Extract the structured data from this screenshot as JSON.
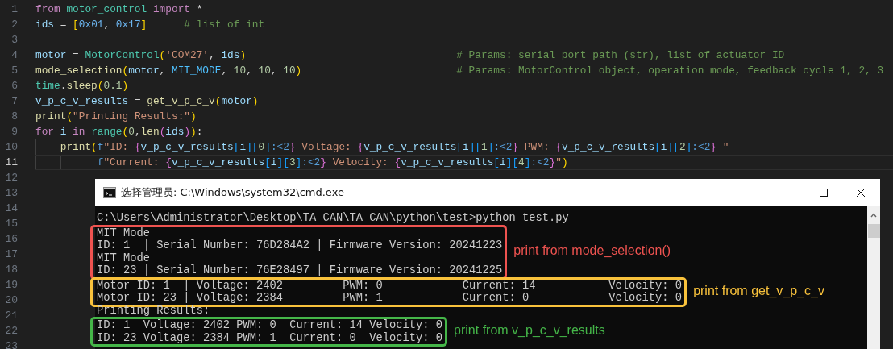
{
  "editor": {
    "lines": [
      {
        "number": "1",
        "current": false,
        "tokens": [
          {
            "text": "from",
            "kind": "keyword"
          },
          {
            "text": " motor_control",
            "kind": "type"
          },
          {
            "text": " import",
            "kind": "keyword"
          },
          {
            "text": " *",
            "kind": "plain"
          }
        ]
      },
      {
        "number": "2",
        "current": false,
        "tokens": [
          {
            "text": "ids",
            "kind": "variable"
          },
          {
            "text": " = ",
            "kind": "plain"
          },
          {
            "text": "[",
            "kind": "bracket1"
          },
          {
            "text": "0x01",
            "kind": "hex"
          },
          {
            "text": ", ",
            "kind": "plain"
          },
          {
            "text": "0x17",
            "kind": "hex"
          },
          {
            "text": "]",
            "kind": "bracket1"
          },
          {
            "text": "      # list of int",
            "kind": "comment"
          }
        ]
      },
      {
        "number": "3",
        "current": false
      },
      {
        "number": "4",
        "current": false,
        "tokens": [
          {
            "text": "motor",
            "kind": "variable"
          },
          {
            "text": " = ",
            "kind": "plain"
          },
          {
            "text": "MotorControl",
            "kind": "type"
          },
          {
            "text": "(",
            "kind": "bracket1"
          },
          {
            "text": "'COM27'",
            "kind": "string"
          },
          {
            "text": ", ",
            "kind": "plain"
          },
          {
            "text": "ids",
            "kind": "variable"
          },
          {
            "text": ")",
            "kind": "bracket1"
          },
          {
            "text": "                                  # Params: serial port path (str), list of actuator ID",
            "kind": "comment"
          }
        ]
      },
      {
        "number": "5",
        "current": false,
        "tokens": [
          {
            "text": "mode_selection",
            "kind": "function"
          },
          {
            "text": "(",
            "kind": "bracket1"
          },
          {
            "text": "motor",
            "kind": "variable"
          },
          {
            "text": ", ",
            "kind": "plain"
          },
          {
            "text": "MIT_MODE",
            "kind": "constant"
          },
          {
            "text": ", ",
            "kind": "plain"
          },
          {
            "text": "10",
            "kind": "number"
          },
          {
            "text": ", ",
            "kind": "plain"
          },
          {
            "text": "10",
            "kind": "number"
          },
          {
            "text": ", ",
            "kind": "plain"
          },
          {
            "text": "10",
            "kind": "number"
          },
          {
            "text": ")",
            "kind": "bracket1"
          },
          {
            "text": "                         # Params: MotorControl object, operation mode, feedback cycle 1, 2, 3",
            "kind": "comment"
          }
        ]
      },
      {
        "number": "6",
        "current": false,
        "tokens": [
          {
            "text": "time",
            "kind": "type"
          },
          {
            "text": ".",
            "kind": "plain"
          },
          {
            "text": "sleep",
            "kind": "function"
          },
          {
            "text": "(",
            "kind": "bracket1"
          },
          {
            "text": "0.1",
            "kind": "number"
          },
          {
            "text": ")",
            "kind": "bracket1"
          }
        ]
      },
      {
        "number": "7",
        "current": false,
        "tokens": [
          {
            "text": "v_p_c_v_results",
            "kind": "variable"
          },
          {
            "text": " = ",
            "kind": "plain"
          },
          {
            "text": "get_v_p_c_v",
            "kind": "function"
          },
          {
            "text": "(",
            "kind": "bracket1"
          },
          {
            "text": "motor",
            "kind": "variable"
          },
          {
            "text": ")",
            "kind": "bracket1"
          }
        ]
      },
      {
        "number": "8",
        "current": false,
        "tokens": [
          {
            "text": "print",
            "kind": "function"
          },
          {
            "text": "(",
            "kind": "bracket1"
          },
          {
            "text": "\"Printing Results:\"",
            "kind": "string"
          },
          {
            "text": ")",
            "kind": "bracket1"
          }
        ]
      },
      {
        "number": "9",
        "current": false,
        "tokens": [
          {
            "text": "for",
            "kind": "keyword"
          },
          {
            "text": " i",
            "kind": "variable"
          },
          {
            "text": " in",
            "kind": "keyword"
          },
          {
            "text": " range",
            "kind": "type"
          },
          {
            "text": "(",
            "kind": "bracket1"
          },
          {
            "text": "0",
            "kind": "number"
          },
          {
            "text": ",",
            "kind": "plain"
          },
          {
            "text": "len",
            "kind": "function"
          },
          {
            "text": "(",
            "kind": "bracket2"
          },
          {
            "text": "ids",
            "kind": "variable"
          },
          {
            "text": ")",
            "kind": "bracket2"
          },
          {
            "text": ")",
            "kind": "bracket1"
          },
          {
            "text": ":",
            "kind": "plain"
          }
        ]
      },
      {
        "number": "10",
        "current": false,
        "kind": "block",
        "tokens": [
          {
            "text": "print",
            "kind": "function"
          },
          {
            "text": "(",
            "kind": "bracket1"
          },
          {
            "text": "f",
            "kind": "prefix"
          },
          {
            "text": "\"ID: ",
            "kind": "string"
          },
          {
            "text": "{",
            "kind": "bracket2"
          },
          {
            "text": "v_p_c_v_results",
            "kind": "variable"
          },
          {
            "text": "[",
            "kind": "bracket3"
          },
          {
            "text": "i",
            "kind": "variable"
          },
          {
            "text": "]",
            "kind": "bracket3"
          },
          {
            "text": "[",
            "kind": "bracket3"
          },
          {
            "text": "0",
            "kind": "number"
          },
          {
            "text": "]",
            "kind": "bracket3"
          },
          {
            "text": ":<2",
            "kind": "format"
          },
          {
            "text": "}",
            "kind": "bracket2"
          },
          {
            "text": " Voltage: ",
            "kind": "string"
          },
          {
            "text": "{",
            "kind": "bracket2"
          },
          {
            "text": "v_p_c_v_results",
            "kind": "variable"
          },
          {
            "text": "[",
            "kind": "bracket3"
          },
          {
            "text": "i",
            "kind": "variable"
          },
          {
            "text": "]",
            "kind": "bracket3"
          },
          {
            "text": "[",
            "kind": "bracket3"
          },
          {
            "text": "1",
            "kind": "number"
          },
          {
            "text": "]",
            "kind": "bracket3"
          },
          {
            "text": ":<2",
            "kind": "format"
          },
          {
            "text": "}",
            "kind": "bracket2"
          },
          {
            "text": " PWM: ",
            "kind": "string"
          },
          {
            "text": "{",
            "kind": "bracket2"
          },
          {
            "text": "v_p_c_v_results",
            "kind": "variable"
          },
          {
            "text": "[",
            "kind": "bracket3"
          },
          {
            "text": "i",
            "kind": "variable"
          },
          {
            "text": "]",
            "kind": "bracket3"
          },
          {
            "text": "[",
            "kind": "bracket3"
          },
          {
            "text": "2",
            "kind": "number"
          },
          {
            "text": "]",
            "kind": "bracket3"
          },
          {
            "text": ":<2",
            "kind": "format"
          },
          {
            "text": "}",
            "kind": "bracket2"
          },
          {
            "text": " \"",
            "kind": "string"
          }
        ]
      },
      {
        "number": "11",
        "current": true,
        "kind": "continuation",
        "tokens": [
          {
            "text": "f",
            "kind": "prefix"
          },
          {
            "text": "\"Current: ",
            "kind": "string"
          },
          {
            "text": "{",
            "kind": "bracket2"
          },
          {
            "text": "v_p_c_v_results",
            "kind": "variable"
          },
          {
            "text": "[",
            "kind": "bracket3"
          },
          {
            "text": "i",
            "kind": "variable"
          },
          {
            "text": "]",
            "kind": "bracket3"
          },
          {
            "text": "[",
            "kind": "bracket3"
          },
          {
            "text": "3",
            "kind": "number"
          },
          {
            "text": "]",
            "kind": "bracket3"
          },
          {
            "text": ":<2",
            "kind": "format"
          },
          {
            "text": "}",
            "kind": "bracket2"
          },
          {
            "text": " Velocity: ",
            "kind": "string"
          },
          {
            "text": "{",
            "kind": "bracket2"
          },
          {
            "text": "v_p_c_v_results",
            "kind": "variable"
          },
          {
            "text": "[",
            "kind": "bracket3"
          },
          {
            "text": "i",
            "kind": "variable"
          },
          {
            "text": "]",
            "kind": "bracket3"
          },
          {
            "text": "[",
            "kind": "bracket3"
          },
          {
            "text": "4",
            "kind": "number"
          },
          {
            "text": "]",
            "kind": "bracket3"
          },
          {
            "text": ":<2",
            "kind": "format"
          },
          {
            "text": "}",
            "kind": "bracket2"
          },
          {
            "text": "\"",
            "kind": "string"
          },
          {
            "text": ")",
            "kind": "bracket1"
          }
        ]
      },
      {
        "number": "12",
        "current": false
      },
      {
        "number": "13",
        "current": false
      },
      {
        "number": "14",
        "current": false
      },
      {
        "number": "15",
        "current": false
      },
      {
        "number": "16",
        "current": false
      },
      {
        "number": "17",
        "current": false
      },
      {
        "number": "18",
        "current": false
      },
      {
        "number": "19",
        "current": false
      },
      {
        "number": "20",
        "current": false
      },
      {
        "number": "21",
        "current": false
      },
      {
        "number": "22",
        "current": false
      },
      {
        "number": "23",
        "current": false
      }
    ]
  },
  "console": {
    "title": "选择管理员: C:\\Windows\\system32\\cmd.exe",
    "blocks": [
      {
        "kind": "plain",
        "lines": [
          "C:\\Users\\Administrator\\Desktop\\TA_CAN\\TA_CAN\\python\\test>python test.py"
        ]
      },
      {
        "kind": "annotated",
        "color": "#ef5350",
        "label": "print from mode_selection()",
        "lines": [
          "MIT Mode",
          "ID: 1  | Serial Number: 76D284A2 | Firmware Version: 20241223",
          "MIT Mode",
          "ID: 23 | Serial Number: 76E28497 | Firmware Version: 20241225"
        ]
      },
      {
        "kind": "annotated",
        "color": "#f9c23c",
        "label": "print from get_v_p_c_v",
        "lines": [
          "Motor ID: 1  | Voltage: 2402         PWM: 0            Current: 14           Velocity: 0",
          "Motor ID: 23 | Voltage: 2384         PWM: 1            Current: 0            Velocity: 0"
        ]
      },
      {
        "kind": "plain",
        "lines": [
          "Printing Results:"
        ]
      },
      {
        "kind": "annotated",
        "color": "#45b649",
        "label": "print from v_p_c_v_results",
        "lines": [
          "ID: 1  Voltage: 2402 PWM: 0  Current: 14 Velocity: 0",
          "ID: 23 Voltage: 2384 PWM: 1  Current: 0  Velocity: 0"
        ]
      }
    ]
  }
}
